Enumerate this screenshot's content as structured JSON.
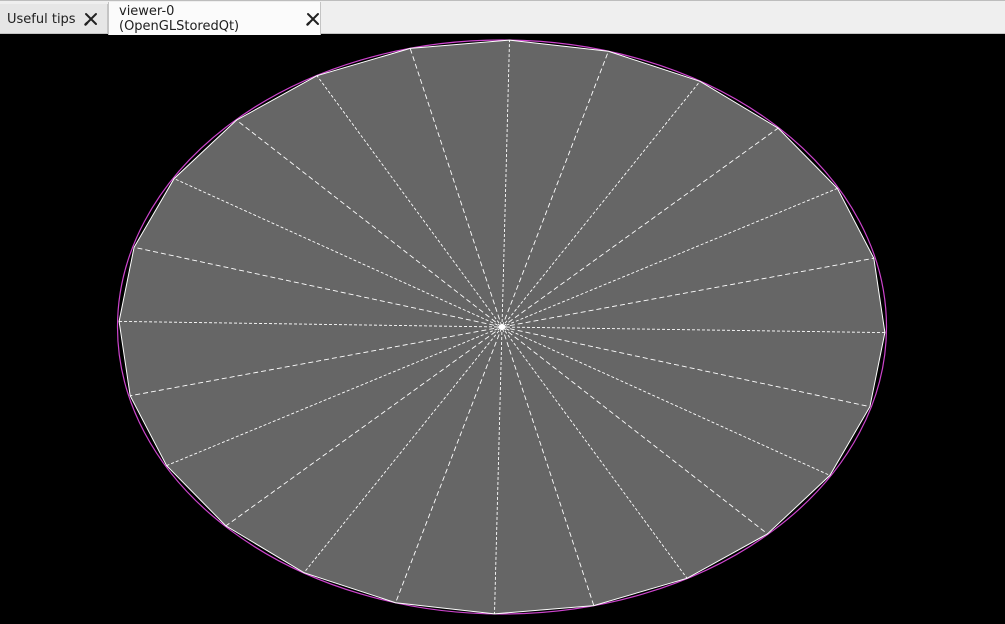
{
  "tabs": [
    {
      "label": "Useful tips",
      "close_icon": "close-icon",
      "active": false
    },
    {
      "label": "viewer-0 (OpenGLStoredQt)",
      "close_icon": "close-icon",
      "active": true
    }
  ],
  "viewer": {
    "background_color": "#000000",
    "disk_fill_color": "#666666",
    "edge_color": "#ffffff",
    "outline_color": "#cc44cc",
    "segments": 24
  }
}
